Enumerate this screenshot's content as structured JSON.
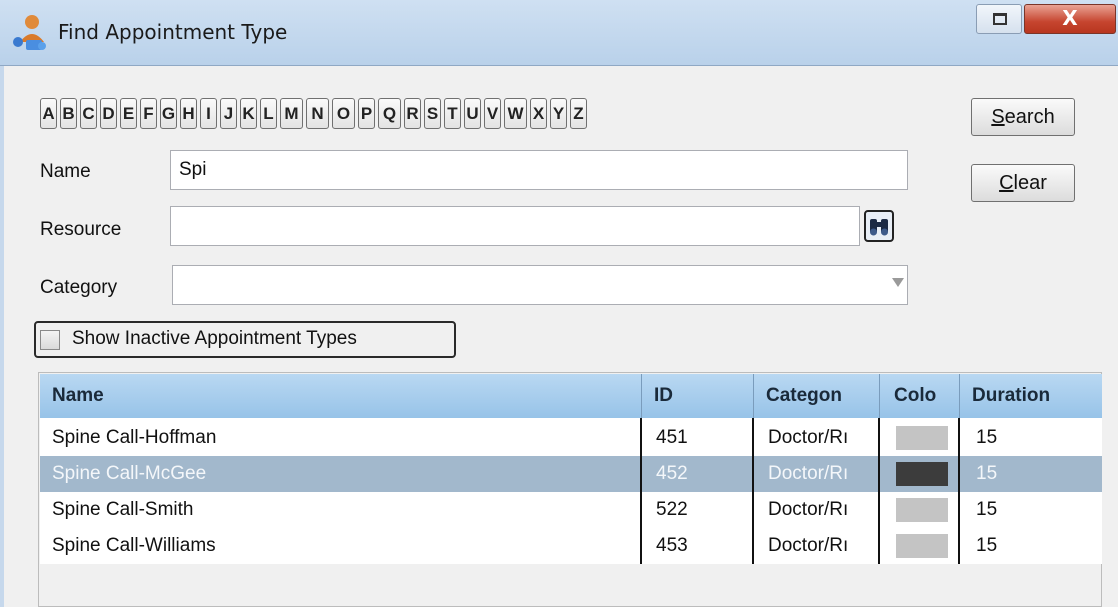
{
  "window": {
    "title": "Find Appointment Type",
    "close_label": "X",
    "accent_color": "#c6452f"
  },
  "letters": [
    "A",
    "B",
    "C",
    "D",
    "E",
    "F",
    "G",
    "H",
    "I",
    "J",
    "K",
    "L",
    "M",
    "N",
    "O",
    "P",
    "Q",
    "R",
    "S",
    "T",
    "U",
    "V",
    "W",
    "X",
    "Y",
    "Z"
  ],
  "buttons": {
    "search_prefix": "S",
    "search_rest": "earch",
    "clear_prefix": "C",
    "clear_rest": "lear"
  },
  "form": {
    "name_label": "Name",
    "name_value": "Spi",
    "resource_label": "Resource",
    "resource_value": "",
    "category_label": "Category",
    "category_value": "",
    "show_inactive_label": "Show Inactive Appointment Types",
    "show_inactive_checked": false
  },
  "grid": {
    "columns": [
      "Name",
      "ID",
      "Categon",
      "Colo",
      "Duration"
    ],
    "rows": [
      {
        "name": "Spine Call-Hoffman",
        "id": "451",
        "category": "Doctor/Rı",
        "color": "#c4c4c4",
        "duration": "15",
        "selected": false
      },
      {
        "name": "Spine Call-McGee",
        "id": "452",
        "category": "Doctor/Rı",
        "color": "#3c3c3c",
        "duration": "15",
        "selected": true
      },
      {
        "name": "Spine Call-Smith",
        "id": "522",
        "category": "Doctor/Rı",
        "color": "#c4c4c4",
        "duration": "15",
        "selected": false
      },
      {
        "name": "Spine Call-Williams",
        "id": "453",
        "category": "Doctor/Rı",
        "color": "#c4c4c4",
        "duration": "15",
        "selected": false
      }
    ]
  }
}
